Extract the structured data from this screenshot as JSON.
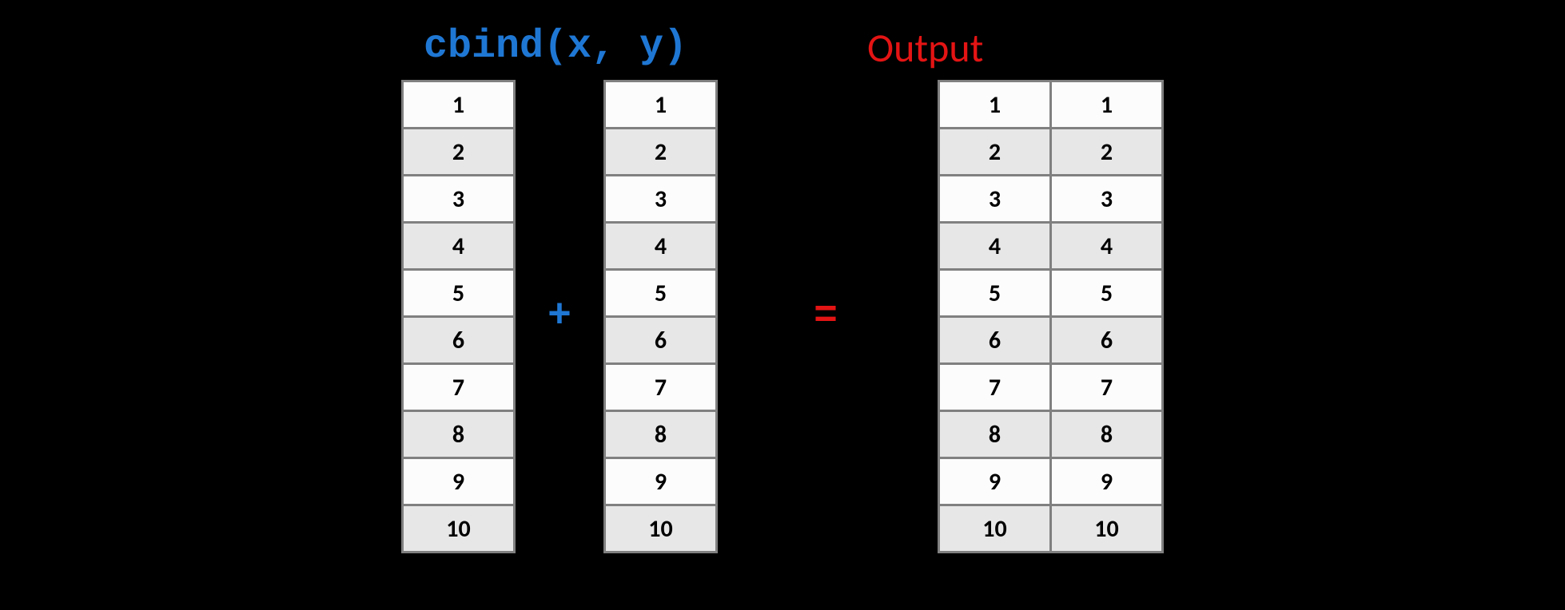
{
  "titles": {
    "code": "cbind(x, y)",
    "output": "Output"
  },
  "operators": {
    "plus": "+",
    "equals": "="
  },
  "columns": {
    "x": [
      "1",
      "2",
      "3",
      "4",
      "5",
      "6",
      "7",
      "8",
      "9",
      "10"
    ],
    "y": [
      "1",
      "2",
      "3",
      "4",
      "5",
      "6",
      "7",
      "8",
      "9",
      "10"
    ],
    "out_x": [
      "1",
      "2",
      "3",
      "4",
      "5",
      "6",
      "7",
      "8",
      "9",
      "10"
    ],
    "out_y": [
      "1",
      "2",
      "3",
      "4",
      "5",
      "6",
      "7",
      "8",
      "9",
      "10"
    ]
  },
  "colors": {
    "code_blue": "#1f77d4",
    "output_red": "#e41414",
    "border_gray": "#808080",
    "row_light": "#fcfcfc",
    "row_dark": "#e7e7e7",
    "background": "#000000"
  }
}
